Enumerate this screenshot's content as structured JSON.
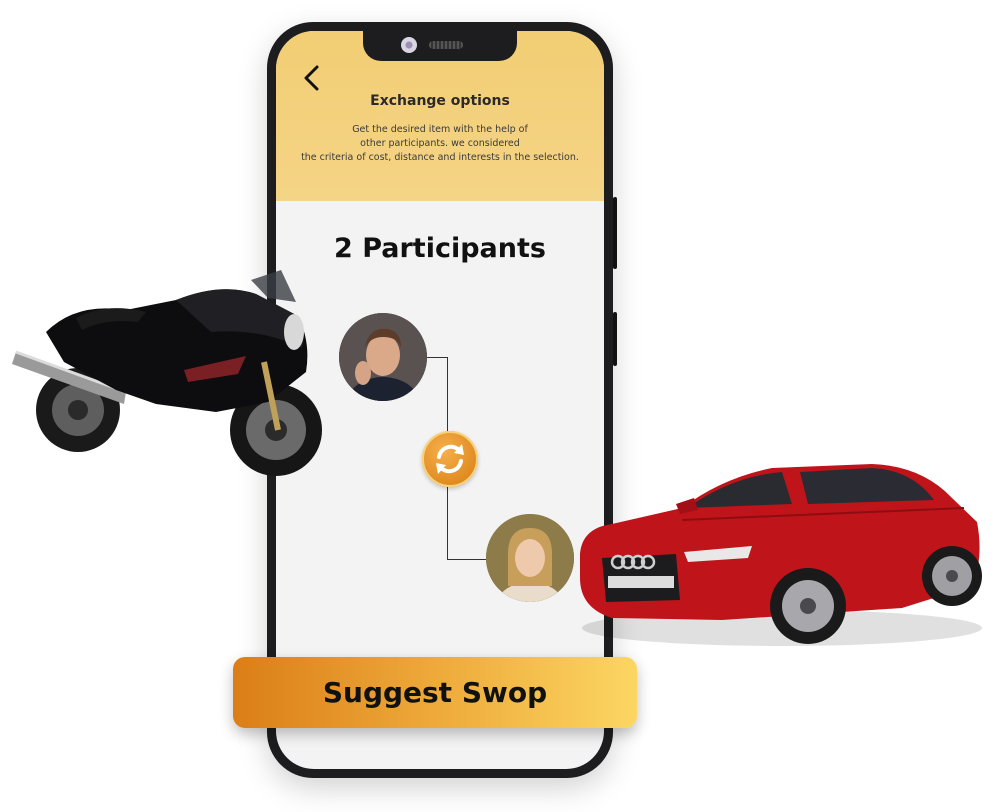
{
  "header": {
    "title": "Exchange options",
    "description_lines": [
      "Get the desired item with the help of",
      "other participants. we considered",
      "the criteria of cost, distance and interests in the selection."
    ]
  },
  "main": {
    "title": "2 Participants"
  },
  "actions": {
    "cta_label": "Suggest Swop"
  },
  "icons": {
    "back": "back-arrow-icon",
    "swap": "swap-arrows-icon"
  },
  "colors": {
    "header_bg": "#f2cd73",
    "cta_start": "#db7e18",
    "cta_end": "#fcd662",
    "swap_accent": "#e58f1c",
    "car_red": "#c9151c"
  }
}
